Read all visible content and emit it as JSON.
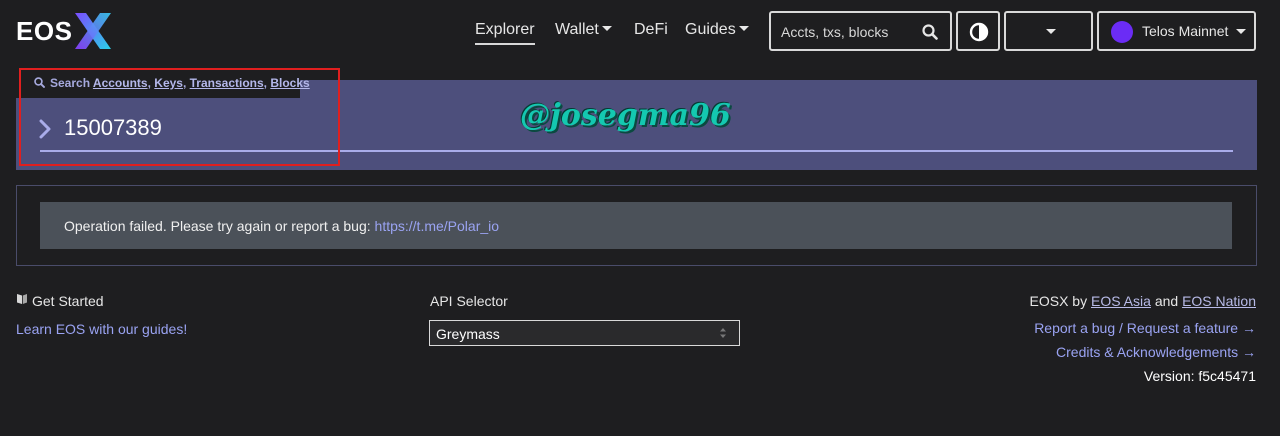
{
  "brand": {
    "logo_text": "EOS",
    "accent": "#6b2cf5"
  },
  "nav": {
    "explorer": "Explorer",
    "wallet": "Wallet",
    "defi": "DeFi",
    "guides": "Guides"
  },
  "header_search": {
    "placeholder": "Accts, txs, blocks",
    "icon": "search-icon"
  },
  "chain": {
    "label": "Telos Mainnet",
    "dot_color": "#6b2cf5"
  },
  "search_panel": {
    "hint_prefix": "Search",
    "hint_links": [
      "Accounts",
      "Keys",
      "Transactions",
      "Blocks"
    ],
    "query": "15007389"
  },
  "watermark": "@josegma96",
  "error": {
    "message": "Operation failed. Please try again or report a bug:",
    "link": "https://t.me/Polar_io"
  },
  "footer": {
    "get_started": "Get Started",
    "learn": "Learn EOS with our guides!",
    "api_label": "API Selector",
    "api_value": "Greymass",
    "credit_prefix": "EOSX by",
    "credit_a": "EOS Asia",
    "credit_and": "and",
    "credit_b": "EOS Nation",
    "report": "Report a bug / Request a feature →",
    "credits": "Credits & Acknowledgements →",
    "version": "Version: f5c45471"
  }
}
